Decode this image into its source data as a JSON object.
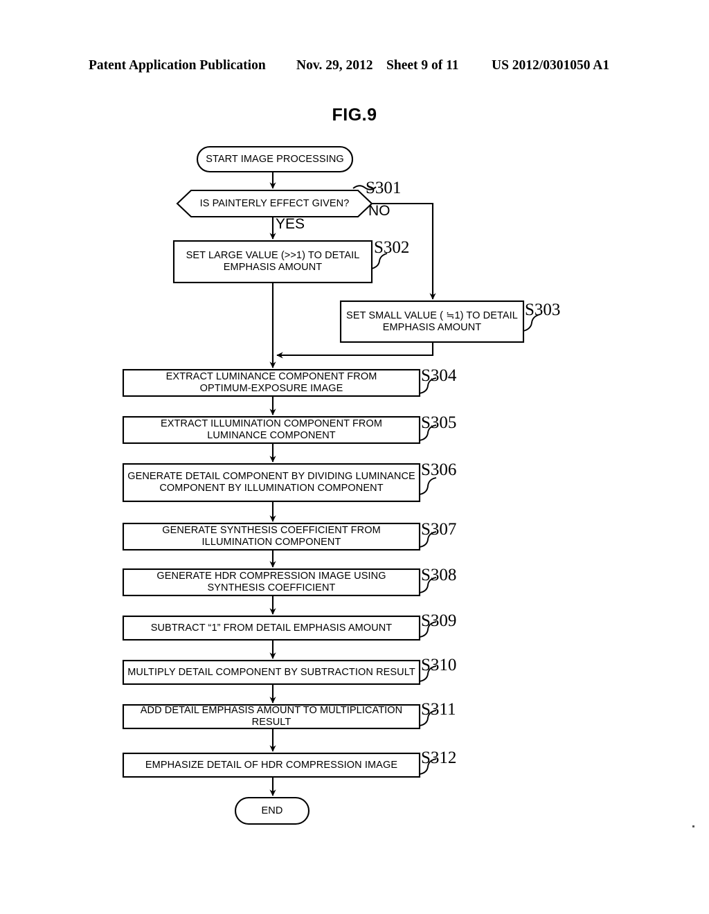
{
  "header": {
    "left": "Patent Application Publication",
    "date": "Nov. 29, 2012",
    "sheet": "Sheet 9 of 11",
    "number": "US 2012/0301050 A1"
  },
  "figure": {
    "title": "FIG.9"
  },
  "flowchart": {
    "start": {
      "label": "START IMAGE PROCESSING"
    },
    "decision": {
      "label": "IS PAINTERLY EFFECT GIVEN?",
      "step": "S301"
    },
    "branches": {
      "yes": "YES",
      "no": "NO"
    },
    "steps": [
      {
        "step": "S302",
        "label": "SET LARGE VALUE (>>1) TO DETAIL\nEMPHASIS AMOUNT"
      },
      {
        "step": "S303",
        "label": "SET SMALL VALUE ( ≒1) TO DETAIL\nEMPHASIS AMOUNT"
      },
      {
        "step": "S304",
        "label": "EXTRACT LUMINANCE COMPONENT FROM\nOPTIMUM-EXPOSURE IMAGE"
      },
      {
        "step": "S305",
        "label": "EXTRACT ILLUMINATION COMPONENT FROM\nLUMINANCE COMPONENT"
      },
      {
        "step": "S306",
        "label": "GENERATE DETAIL COMPONENT BY DIVIDING LUMINANCE\nCOMPONENT BY ILLUMINATION COMPONENT"
      },
      {
        "step": "S307",
        "label": "GENERATE SYNTHESIS COEFFICIENT FROM\nILLUMINATION COMPONENT"
      },
      {
        "step": "S308",
        "label": "GENERATE HDR COMPRESSION IMAGE USING\nSYNTHESIS COEFFICIENT"
      },
      {
        "step": "S309",
        "label": "SUBTRACT “1” FROM DETAIL EMPHASIS AMOUNT"
      },
      {
        "step": "S310",
        "label": "MULTIPLY DETAIL COMPONENT BY SUBTRACTION RESULT"
      },
      {
        "step": "S311",
        "label": "ADD DETAIL EMPHASIS AMOUNT TO MULTIPLICATION RESULT"
      },
      {
        "step": "S312",
        "label": "EMPHASIZE DETAIL OF HDR COMPRESSION IMAGE"
      }
    ],
    "end": {
      "label": "END"
    }
  },
  "colors": {
    "ink": "#000000",
    "paper": "#ffffff"
  }
}
